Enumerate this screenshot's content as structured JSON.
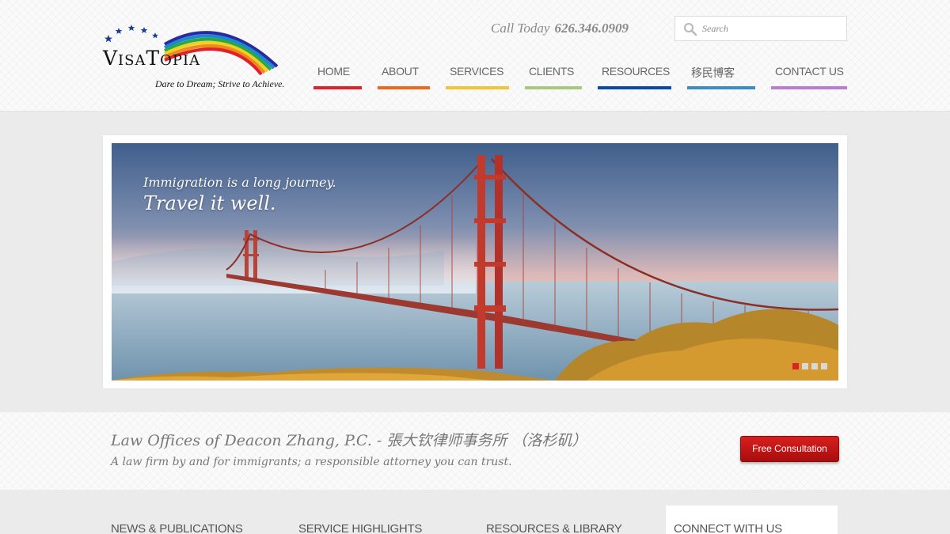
{
  "logo": {
    "wordmark": "VisaTopia",
    "tagline": "Dare to Dream; Strive to Achieve."
  },
  "header": {
    "call_label": "Call Today",
    "phone": "626.346.0909",
    "search_placeholder": "Search"
  },
  "nav": [
    {
      "label": "HOME",
      "color": "#e0202a"
    },
    {
      "label": "ABOUT",
      "color": "#ea6a1c"
    },
    {
      "label": "SERVICES",
      "color": "#f0c432"
    },
    {
      "label": "CLIENTS",
      "color": "#a6c97a"
    },
    {
      "label": "RESOURCES",
      "color": "#0a4aa6"
    },
    {
      "label": "移民博客",
      "color": "#3b8cc4"
    },
    {
      "label": "CONTACT US",
      "color": "#b97cd2"
    }
  ],
  "slider": {
    "line1": "Immigration is a long journey.",
    "line2": "Travel it well.",
    "active_dot": 0,
    "dot_count": 4,
    "active_color": "#e0202a"
  },
  "intro": {
    "firm_name": "Law Offices of Deacon Zhang, P.C. - 張大钦律师事务所 （洛杉矶）",
    "subtitle": "A law firm by and for immigrants; a responsible attorney you can trust.",
    "cta_label": "Free Consultation"
  },
  "footer_columns": [
    {
      "title": "NEWS & PUBLICATIONS"
    },
    {
      "title": "SERVICE HIGHLIGHTS"
    },
    {
      "title": "RESOURCES & LIBRARY"
    },
    {
      "title": "CONNECT WITH US"
    }
  ]
}
